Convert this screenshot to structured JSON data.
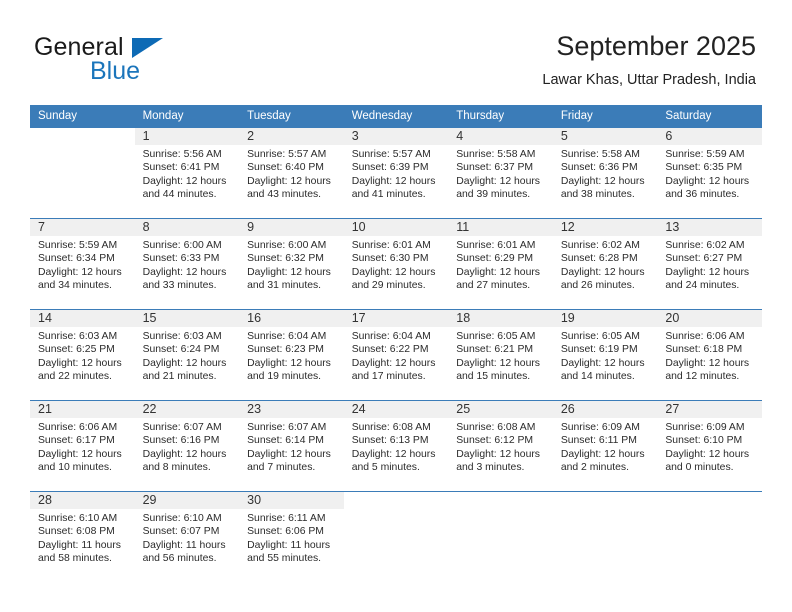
{
  "brand": {
    "word_one": "General",
    "word_two": "Blue",
    "triangle_icon": "blue-triangle-logo-mark"
  },
  "header": {
    "title": "September 2025",
    "subtitle": "Lawar Khas, Uttar Pradesh, India"
  },
  "colors": {
    "header_blue": "#3b7cb8",
    "brand_blue": "#1b75bb",
    "daynum_band": "#f0f0f0",
    "text": "#2b2b2b"
  },
  "calendar": {
    "weekday_headers": [
      "Sunday",
      "Monday",
      "Tuesday",
      "Wednesday",
      "Thursday",
      "Friday",
      "Saturday"
    ],
    "weeks": [
      [
        {
          "day": "",
          "sunrise": "",
          "sunset": "",
          "daylight_line1": "",
          "daylight_line2": "",
          "blank": true
        },
        {
          "day": "1",
          "sunrise": "Sunrise: 5:56 AM",
          "sunset": "Sunset: 6:41 PM",
          "daylight_line1": "Daylight: 12 hours",
          "daylight_line2": "and 44 minutes."
        },
        {
          "day": "2",
          "sunrise": "Sunrise: 5:57 AM",
          "sunset": "Sunset: 6:40 PM",
          "daylight_line1": "Daylight: 12 hours",
          "daylight_line2": "and 43 minutes."
        },
        {
          "day": "3",
          "sunrise": "Sunrise: 5:57 AM",
          "sunset": "Sunset: 6:39 PM",
          "daylight_line1": "Daylight: 12 hours",
          "daylight_line2": "and 41 minutes."
        },
        {
          "day": "4",
          "sunrise": "Sunrise: 5:58 AM",
          "sunset": "Sunset: 6:37 PM",
          "daylight_line1": "Daylight: 12 hours",
          "daylight_line2": "and 39 minutes."
        },
        {
          "day": "5",
          "sunrise": "Sunrise: 5:58 AM",
          "sunset": "Sunset: 6:36 PM",
          "daylight_line1": "Daylight: 12 hours",
          "daylight_line2": "and 38 minutes."
        },
        {
          "day": "6",
          "sunrise": "Sunrise: 5:59 AM",
          "sunset": "Sunset: 6:35 PM",
          "daylight_line1": "Daylight: 12 hours",
          "daylight_line2": "and 36 minutes."
        }
      ],
      [
        {
          "day": "7",
          "sunrise": "Sunrise: 5:59 AM",
          "sunset": "Sunset: 6:34 PM",
          "daylight_line1": "Daylight: 12 hours",
          "daylight_line2": "and 34 minutes."
        },
        {
          "day": "8",
          "sunrise": "Sunrise: 6:00 AM",
          "sunset": "Sunset: 6:33 PM",
          "daylight_line1": "Daylight: 12 hours",
          "daylight_line2": "and 33 minutes."
        },
        {
          "day": "9",
          "sunrise": "Sunrise: 6:00 AM",
          "sunset": "Sunset: 6:32 PM",
          "daylight_line1": "Daylight: 12 hours",
          "daylight_line2": "and 31 minutes."
        },
        {
          "day": "10",
          "sunrise": "Sunrise: 6:01 AM",
          "sunset": "Sunset: 6:30 PM",
          "daylight_line1": "Daylight: 12 hours",
          "daylight_line2": "and 29 minutes."
        },
        {
          "day": "11",
          "sunrise": "Sunrise: 6:01 AM",
          "sunset": "Sunset: 6:29 PM",
          "daylight_line1": "Daylight: 12 hours",
          "daylight_line2": "and 27 minutes."
        },
        {
          "day": "12",
          "sunrise": "Sunrise: 6:02 AM",
          "sunset": "Sunset: 6:28 PM",
          "daylight_line1": "Daylight: 12 hours",
          "daylight_line2": "and 26 minutes."
        },
        {
          "day": "13",
          "sunrise": "Sunrise: 6:02 AM",
          "sunset": "Sunset: 6:27 PM",
          "daylight_line1": "Daylight: 12 hours",
          "daylight_line2": "and 24 minutes."
        }
      ],
      [
        {
          "day": "14",
          "sunrise": "Sunrise: 6:03 AM",
          "sunset": "Sunset: 6:25 PM",
          "daylight_line1": "Daylight: 12 hours",
          "daylight_line2": "and 22 minutes."
        },
        {
          "day": "15",
          "sunrise": "Sunrise: 6:03 AM",
          "sunset": "Sunset: 6:24 PM",
          "daylight_line1": "Daylight: 12 hours",
          "daylight_line2": "and 21 minutes."
        },
        {
          "day": "16",
          "sunrise": "Sunrise: 6:04 AM",
          "sunset": "Sunset: 6:23 PM",
          "daylight_line1": "Daylight: 12 hours",
          "daylight_line2": "and 19 minutes."
        },
        {
          "day": "17",
          "sunrise": "Sunrise: 6:04 AM",
          "sunset": "Sunset: 6:22 PM",
          "daylight_line1": "Daylight: 12 hours",
          "daylight_line2": "and 17 minutes."
        },
        {
          "day": "18",
          "sunrise": "Sunrise: 6:05 AM",
          "sunset": "Sunset: 6:21 PM",
          "daylight_line1": "Daylight: 12 hours",
          "daylight_line2": "and 15 minutes."
        },
        {
          "day": "19",
          "sunrise": "Sunrise: 6:05 AM",
          "sunset": "Sunset: 6:19 PM",
          "daylight_line1": "Daylight: 12 hours",
          "daylight_line2": "and 14 minutes."
        },
        {
          "day": "20",
          "sunrise": "Sunrise: 6:06 AM",
          "sunset": "Sunset: 6:18 PM",
          "daylight_line1": "Daylight: 12 hours",
          "daylight_line2": "and 12 minutes."
        }
      ],
      [
        {
          "day": "21",
          "sunrise": "Sunrise: 6:06 AM",
          "sunset": "Sunset: 6:17 PM",
          "daylight_line1": "Daylight: 12 hours",
          "daylight_line2": "and 10 minutes."
        },
        {
          "day": "22",
          "sunrise": "Sunrise: 6:07 AM",
          "sunset": "Sunset: 6:16 PM",
          "daylight_line1": "Daylight: 12 hours",
          "daylight_line2": "and 8 minutes."
        },
        {
          "day": "23",
          "sunrise": "Sunrise: 6:07 AM",
          "sunset": "Sunset: 6:14 PM",
          "daylight_line1": "Daylight: 12 hours",
          "daylight_line2": "and 7 minutes."
        },
        {
          "day": "24",
          "sunrise": "Sunrise: 6:08 AM",
          "sunset": "Sunset: 6:13 PM",
          "daylight_line1": "Daylight: 12 hours",
          "daylight_line2": "and 5 minutes."
        },
        {
          "day": "25",
          "sunrise": "Sunrise: 6:08 AM",
          "sunset": "Sunset: 6:12 PM",
          "daylight_line1": "Daylight: 12 hours",
          "daylight_line2": "and 3 minutes."
        },
        {
          "day": "26",
          "sunrise": "Sunrise: 6:09 AM",
          "sunset": "Sunset: 6:11 PM",
          "daylight_line1": "Daylight: 12 hours",
          "daylight_line2": "and 2 minutes."
        },
        {
          "day": "27",
          "sunrise": "Sunrise: 6:09 AM",
          "sunset": "Sunset: 6:10 PM",
          "daylight_line1": "Daylight: 12 hours",
          "daylight_line2": "and 0 minutes."
        }
      ],
      [
        {
          "day": "28",
          "sunrise": "Sunrise: 6:10 AM",
          "sunset": "Sunset: 6:08 PM",
          "daylight_line1": "Daylight: 11 hours",
          "daylight_line2": "and 58 minutes."
        },
        {
          "day": "29",
          "sunrise": "Sunrise: 6:10 AM",
          "sunset": "Sunset: 6:07 PM",
          "daylight_line1": "Daylight: 11 hours",
          "daylight_line2": "and 56 minutes."
        },
        {
          "day": "30",
          "sunrise": "Sunrise: 6:11 AM",
          "sunset": "Sunset: 6:06 PM",
          "daylight_line1": "Daylight: 11 hours",
          "daylight_line2": "and 55 minutes."
        },
        {
          "day": "",
          "sunrise": "",
          "sunset": "",
          "daylight_line1": "",
          "daylight_line2": "",
          "blank": true
        },
        {
          "day": "",
          "sunrise": "",
          "sunset": "",
          "daylight_line1": "",
          "daylight_line2": "",
          "blank": true
        },
        {
          "day": "",
          "sunrise": "",
          "sunset": "",
          "daylight_line1": "",
          "daylight_line2": "",
          "blank": true
        },
        {
          "day": "",
          "sunrise": "",
          "sunset": "",
          "daylight_line1": "",
          "daylight_line2": "",
          "blank": true
        }
      ]
    ]
  }
}
